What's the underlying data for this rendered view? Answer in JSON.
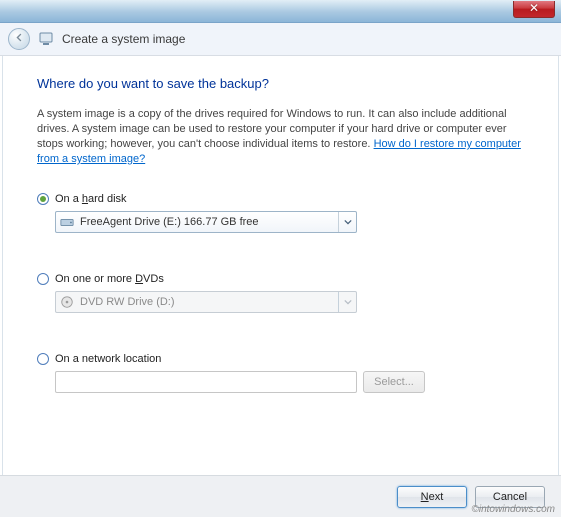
{
  "window": {
    "title": "Create a system image"
  },
  "page": {
    "heading": "Where do you want to save the backup?",
    "description_pre": "A system image is a copy of the drives required for Windows to run. It can also include additional drives. A system image can be used to restore your computer if your hard drive or computer ever stops working; however, you can't choose individual items to restore. ",
    "help_link": "How do I restore my computer from a system image?"
  },
  "options": {
    "hard_disk": {
      "label_pre": "On a ",
      "label_mnemonic": "h",
      "label_post": "ard disk",
      "checked": true,
      "combo_value": "FreeAgent Drive (E:)  166.77 GB free"
    },
    "dvd": {
      "label_pre": "On one or more ",
      "label_mnemonic": "D",
      "label_post": "VDs",
      "checked": false,
      "combo_value": "DVD RW Drive (D:)"
    },
    "network": {
      "label": "On a network location",
      "checked": false,
      "path_value": "",
      "select_label": "Select..."
    }
  },
  "footer": {
    "next_pre": "",
    "next_mnemonic": "N",
    "next_post": "ext",
    "cancel": "Cancel"
  },
  "watermark": "©intowindows.com"
}
